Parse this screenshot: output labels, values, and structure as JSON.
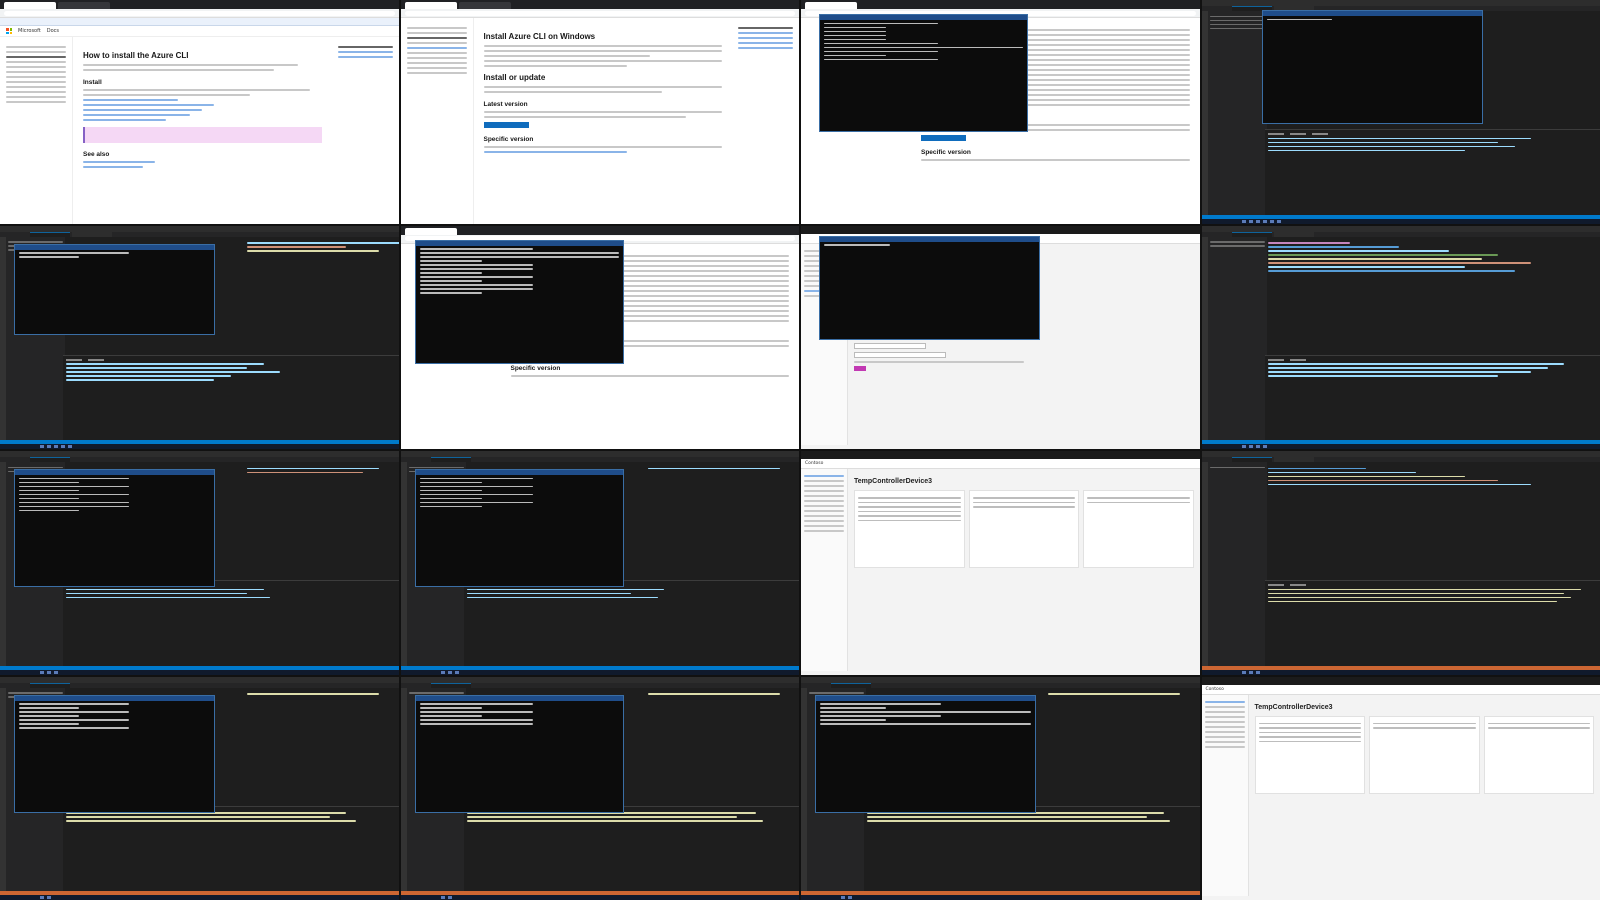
{
  "docs": {
    "brand": "Microsoft",
    "section": "Docs",
    "title": "How to install the Azure CLI",
    "install_heading": "Install",
    "see_also_heading": "See also",
    "install_title": "Install Azure CLI on Windows",
    "install_or_update": "Install or update",
    "latest_version": "Latest version",
    "specific_version": "Specific version",
    "latest_button": "Latest release of the Azure CLI",
    "note_label": "Note"
  },
  "portal": {
    "app_name": "Contoso",
    "device_title": "TempControllerDevice3"
  },
  "colors": {
    "vscode_status": "#007acc",
    "vscode_status_debug": "#cc6633",
    "accent_pink": "#c239b3",
    "ms_blue": "#0f6cbd"
  }
}
